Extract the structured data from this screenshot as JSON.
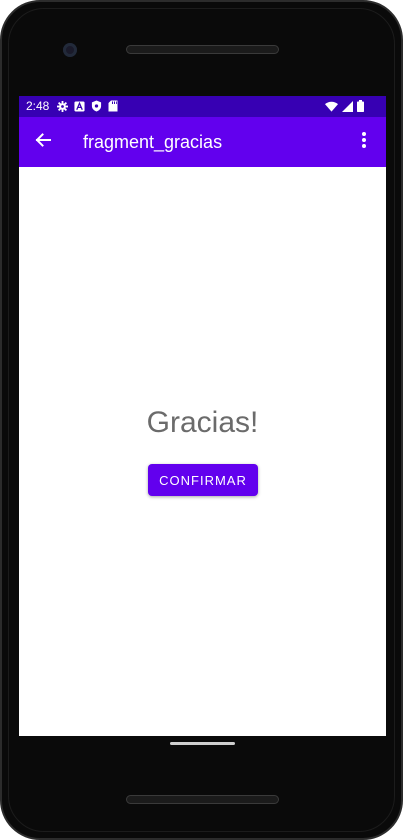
{
  "status_bar": {
    "time": "2:48",
    "left_icons": [
      "gear-icon",
      "a-icon",
      "shield-icon",
      "sd-card-icon"
    ],
    "right_icons": [
      "wifi-icon",
      "signal-icon",
      "battery-icon"
    ]
  },
  "app_bar": {
    "title": "fragment_gracias",
    "back_icon": "arrow-back-icon",
    "overflow_icon": "more-vert-icon"
  },
  "content": {
    "message": "Gracias!",
    "button_label": "CONFIRMAR"
  },
  "colors": {
    "status_bar": "#3700b3",
    "primary": "#6200ee",
    "message_text": "#6b6b6b"
  }
}
